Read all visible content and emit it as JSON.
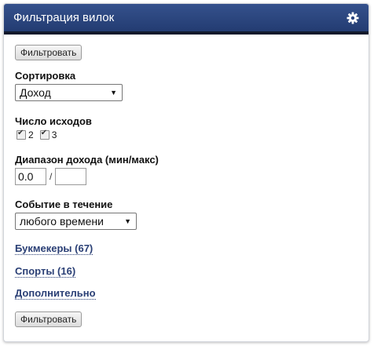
{
  "header": {
    "title": "Фильтрация вилок",
    "settings_icon": "gear-icon"
  },
  "filter_button_label": "Фильтровать",
  "sort": {
    "label": "Сортировка",
    "selected": "Доход"
  },
  "outcomes": {
    "label": "Число исходов",
    "options": [
      "2",
      "3"
    ],
    "checked": [
      true,
      true
    ]
  },
  "income_range": {
    "label": "Диапазон дохода (мин/макс)",
    "min": "0.0",
    "max": "",
    "separator": "/"
  },
  "event_time": {
    "label": "Событие в течение",
    "selected": "любого времени"
  },
  "links": {
    "bookmakers": "Букмекеры (67)",
    "sports": "Спорты (16)",
    "additional": "Дополнительно"
  },
  "colors": {
    "header_bg": "#2c4680",
    "link": "#2a3f75"
  }
}
